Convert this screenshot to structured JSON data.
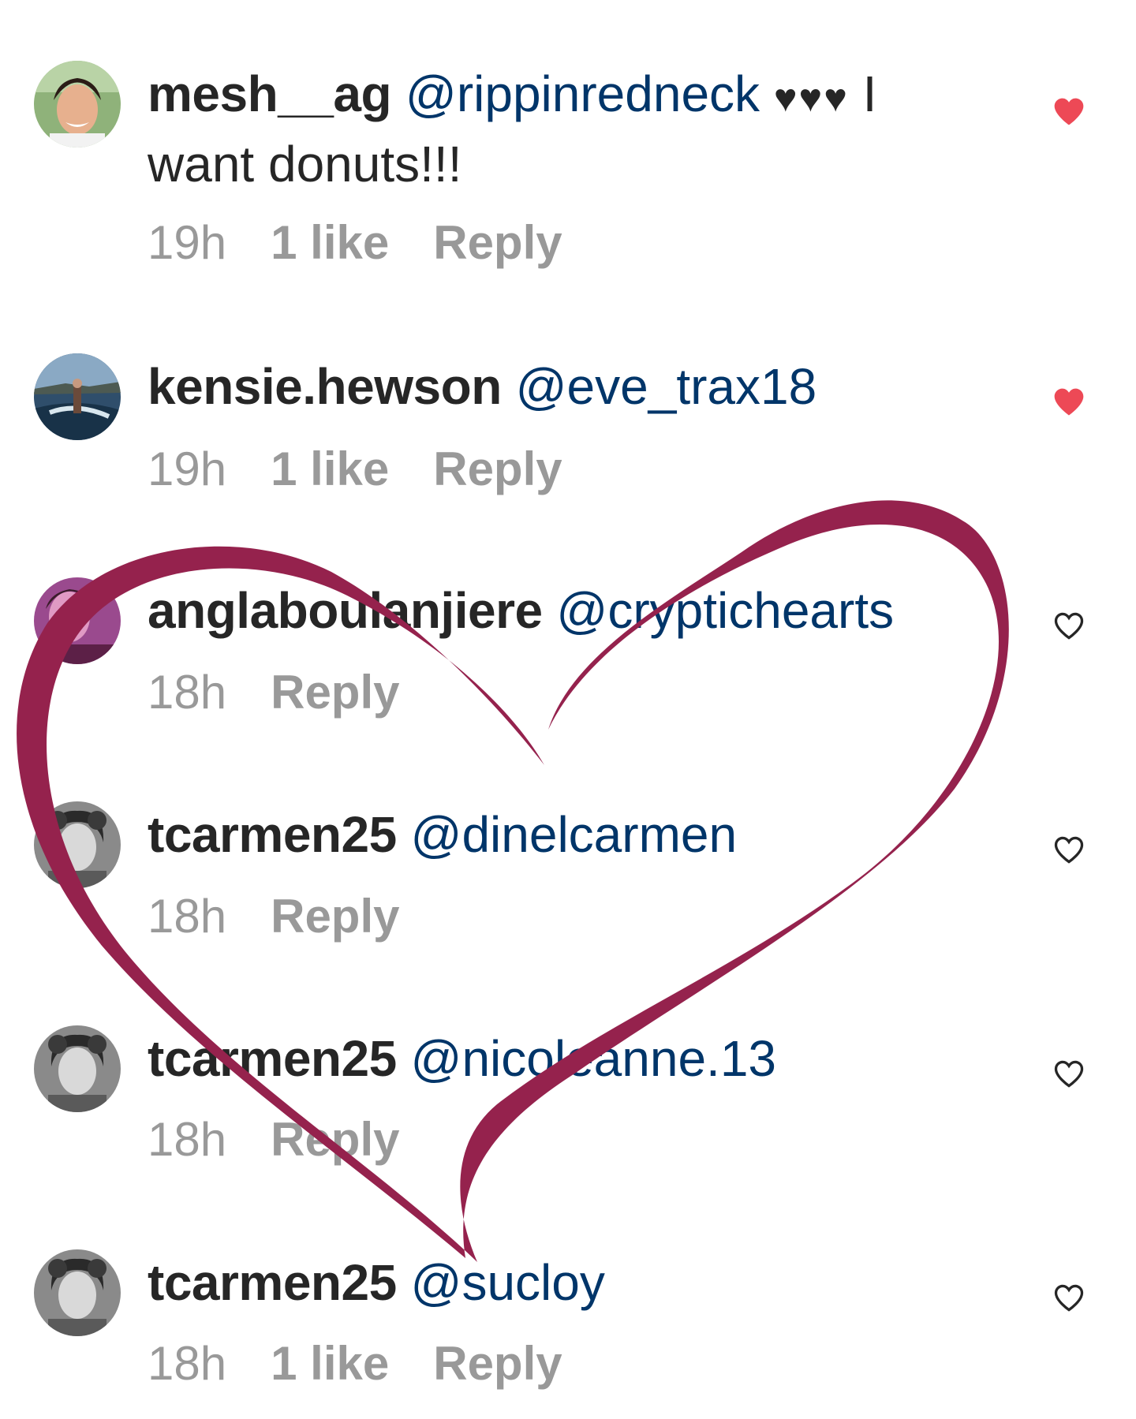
{
  "comments": [
    {
      "username": "mesh__ag",
      "mention": "@rippinredneck",
      "emoji": "♥♥♥",
      "text_line1_tail": "I",
      "text_line2": "want donuts!!!",
      "time": "19h",
      "likes": "1 like",
      "reply": "Reply",
      "liked": true,
      "avatar_icon": "profile-photo-woman-smiling"
    },
    {
      "username": "kensie.hewson",
      "mention": "@eve_trax18",
      "time": "19h",
      "likes": "1 like",
      "reply": "Reply",
      "liked": true,
      "avatar_icon": "profile-photo-wakeboarding"
    },
    {
      "username": "anglaboulanjiere",
      "mention": "@cryptichearts",
      "time": "18h",
      "reply": "Reply",
      "liked": false,
      "avatar_icon": "profile-photo-woman-pink"
    },
    {
      "username": "tcarmen25",
      "mention": "@dinelcarmen",
      "time": "18h",
      "reply": "Reply",
      "liked": false,
      "avatar_icon": "profile-photo-woman-bw"
    },
    {
      "username": "tcarmen25",
      "mention": "@nicoleanne.13",
      "time": "18h",
      "reply": "Reply",
      "liked": false,
      "avatar_icon": "profile-photo-woman-bw"
    },
    {
      "username": "tcarmen25",
      "mention": "@sucloy",
      "time": "18h",
      "likes": "1 like",
      "reply": "Reply",
      "liked": false,
      "avatar_icon": "profile-photo-woman-bw"
    }
  ],
  "colors": {
    "text": "#262626",
    "mention": "#003569",
    "meta": "#999999",
    "liked_heart": "#ed4956",
    "overlay_heart": "#95224d"
  },
  "overlay": {
    "icon": "hand-drawn-heart-overlay"
  }
}
